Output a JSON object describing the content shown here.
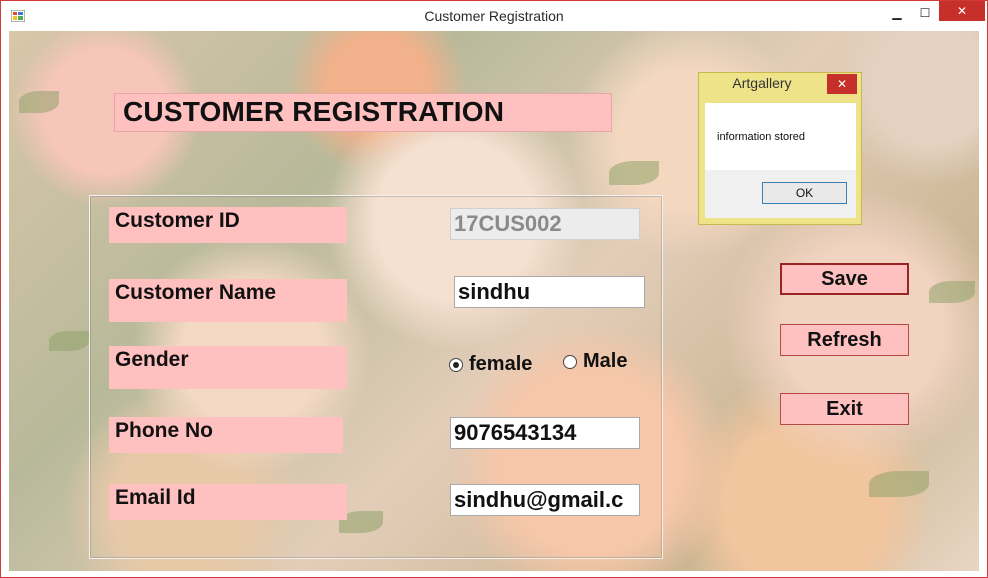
{
  "window": {
    "title": "Customer Registration",
    "minimize_glyph": "▁",
    "maximize_glyph": "☐",
    "close_glyph": "✕"
  },
  "form": {
    "heading": "CUSTOMER REGISTRATION",
    "labels": {
      "customer_id": "Customer ID",
      "customer_name": "Customer Name",
      "gender": "Gender",
      "phone": "Phone No",
      "email": "Email Id"
    },
    "values": {
      "customer_id": "17CUS002",
      "customer_name": "sindhu",
      "phone": "9076543134",
      "email": "sindhu@gmail.c"
    },
    "gender_options": [
      {
        "label": "female",
        "selected": true
      },
      {
        "label": "Male",
        "selected": false
      }
    ]
  },
  "buttons": {
    "save": "Save",
    "refresh": "Refresh",
    "exit": "Exit"
  },
  "message_box": {
    "title": "Artgallery",
    "message": "information stored",
    "ok": "OK",
    "close_glyph": "✕"
  },
  "colors": {
    "label_bg": "#ffc0c0",
    "close_red": "#c7302a",
    "msgbox_frame": "#efe38a"
  }
}
